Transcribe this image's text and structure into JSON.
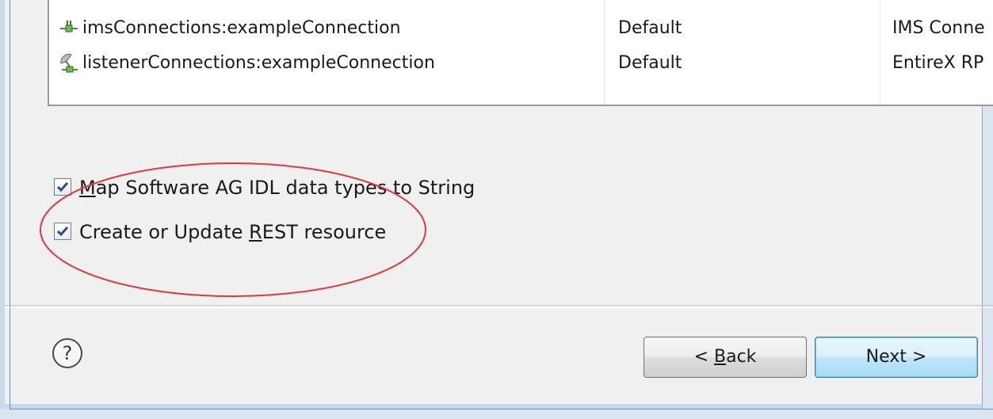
{
  "connections": {
    "rows": [
      {
        "name": "imsConnections:exampleConnection",
        "type": "Default",
        "description": "IMS Conne",
        "icon": "plug-connection-icon"
      },
      {
        "name": "listenerConnections:exampleConnection",
        "type": "Default",
        "description": "EntireX RP",
        "icon": "satellite-listener-icon"
      }
    ]
  },
  "options": {
    "map_idl": {
      "label_mnemonic": "M",
      "label_rest": "ap Software AG IDL data types to String",
      "checked": true
    },
    "create_rest": {
      "label_pre": "Create or Update ",
      "label_mnemonic": "R",
      "label_post": "EST resource",
      "checked": true
    }
  },
  "buttons": {
    "help_symbol": "?",
    "back_pre": "< ",
    "back_mnemonic": "B",
    "back_post": "ack",
    "next_label": "Next >"
  },
  "colors": {
    "annotation": "#e0383c",
    "checkmark": "#2a4a8c",
    "next_button_border": "#3c7fb1"
  }
}
